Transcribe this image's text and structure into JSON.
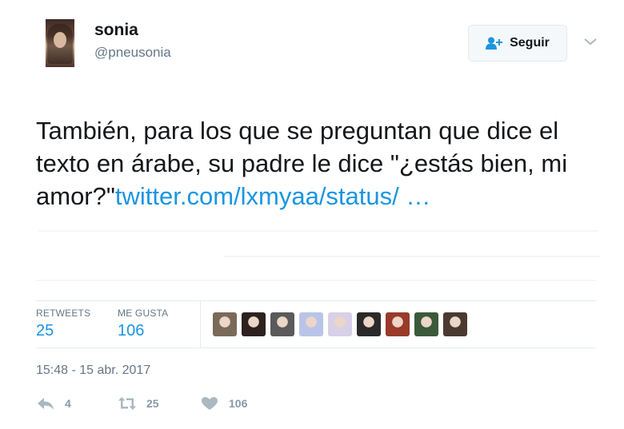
{
  "user": {
    "display_name": "sonia",
    "handle": "@pneusonia"
  },
  "follow_button": {
    "label": "Seguir"
  },
  "tweet": {
    "text": "También, para los que se preguntan que dice el texto en árabe, su padre le dice \"¿estás bien, mi amor?\"",
    "link": "twitter.com/lxmyaa/status/ …"
  },
  "stats": {
    "retweets_label": "RETWEETS",
    "retweets_value": "25",
    "likes_label": "ME GUSTA",
    "likes_value": "106"
  },
  "likers": {
    "avatar_colors": [
      "#7a6a5a",
      "#2e2220",
      "#5a5a5a",
      "#b9c4e8",
      "#d8d0e6",
      "#2a2a2a",
      "#9a3a2a",
      "#3a5a3a",
      "#4a3a30"
    ]
  },
  "timestamp": "15:48 - 15 abr. 2017",
  "actions": {
    "reply_count": "4",
    "retweet_count": "25",
    "like_count": "106"
  },
  "colors": {
    "link": "#1b95e0",
    "muted": "#657786",
    "icon": "#aab8c2"
  }
}
